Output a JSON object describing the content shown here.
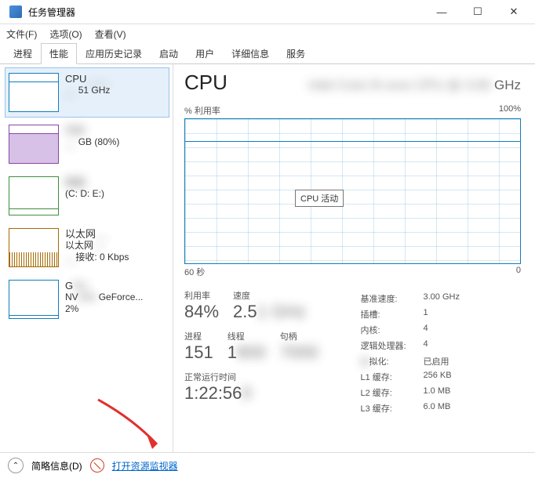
{
  "window": {
    "title": "任务管理器"
  },
  "menus": {
    "file": "文件(F)",
    "options": "选项(O)",
    "view": "查看(V)"
  },
  "tabs": [
    "进程",
    "性能",
    "应用历史记录",
    "启动",
    "用户",
    "详细信息",
    "服务"
  ],
  "active_tab_index": 1,
  "sidebar": {
    "cpu": {
      "title": "CPU",
      "sub": "51 GHz"
    },
    "mem": {
      "title": "内存",
      "sub": "GB (80%)"
    },
    "disk": {
      "title": "磁盘",
      "sub": "(C: D: E:)"
    },
    "net": {
      "title": "以太网",
      "sub1": "以太网",
      "sub2": "接收: 0 Kbps"
    },
    "gpu": {
      "title": "GPU",
      "sub1": "NVIDIA GeForce...",
      "sub2": "2%"
    }
  },
  "main": {
    "title": "CPU",
    "subtitle_suffix": "GHz",
    "chart": {
      "ylabel": "% 利用率",
      "ymax": "100%",
      "xlabel_left": "60 秒",
      "xlabel_right": "0",
      "tooltip": "CPU 活动"
    },
    "left_labels": {
      "util": "利用率",
      "speed": "速度",
      "proc": "进程",
      "threads": "线程",
      "handles": "句柄",
      "uptime": "正常运行时间"
    },
    "left_values": {
      "util": "84%",
      "speed": "2.5",
      "proc": "151",
      "threads": "1",
      "uptime": "1:22:56"
    },
    "props": {
      "base_speed_l": "基准速度:",
      "base_speed_v": "3.00 GHz",
      "sockets_l": "插槽:",
      "sockets_v": "1",
      "cores_l": "内核:",
      "cores_v": "4",
      "logical_l": "逻辑处理器:",
      "logical_v": "4",
      "virt_l": "虚拟化:",
      "virt_v": "已启用",
      "l1_l": "L1 缓存:",
      "l1_v": "256 KB",
      "l2_l": "L2 缓存:",
      "l2_v": "1.0 MB",
      "l3_l": "L3 缓存:",
      "l3_v": "6.0 MB"
    }
  },
  "statusbar": {
    "fewer": "简略信息(D)",
    "open_resmon": "打开资源监视器"
  },
  "chart_data": {
    "type": "line",
    "title": "% 利用率",
    "xlabel": "60 秒 → 0",
    "ylabel": "% 利用率",
    "ylim": [
      0,
      100
    ],
    "x_seconds_ago": [
      60,
      55,
      50,
      45,
      40,
      35,
      30,
      25,
      20,
      15,
      10,
      5,
      0
    ],
    "values_percent": [
      85,
      84,
      83,
      86,
      84,
      85,
      84,
      83,
      85,
      82,
      84,
      85,
      84
    ]
  }
}
